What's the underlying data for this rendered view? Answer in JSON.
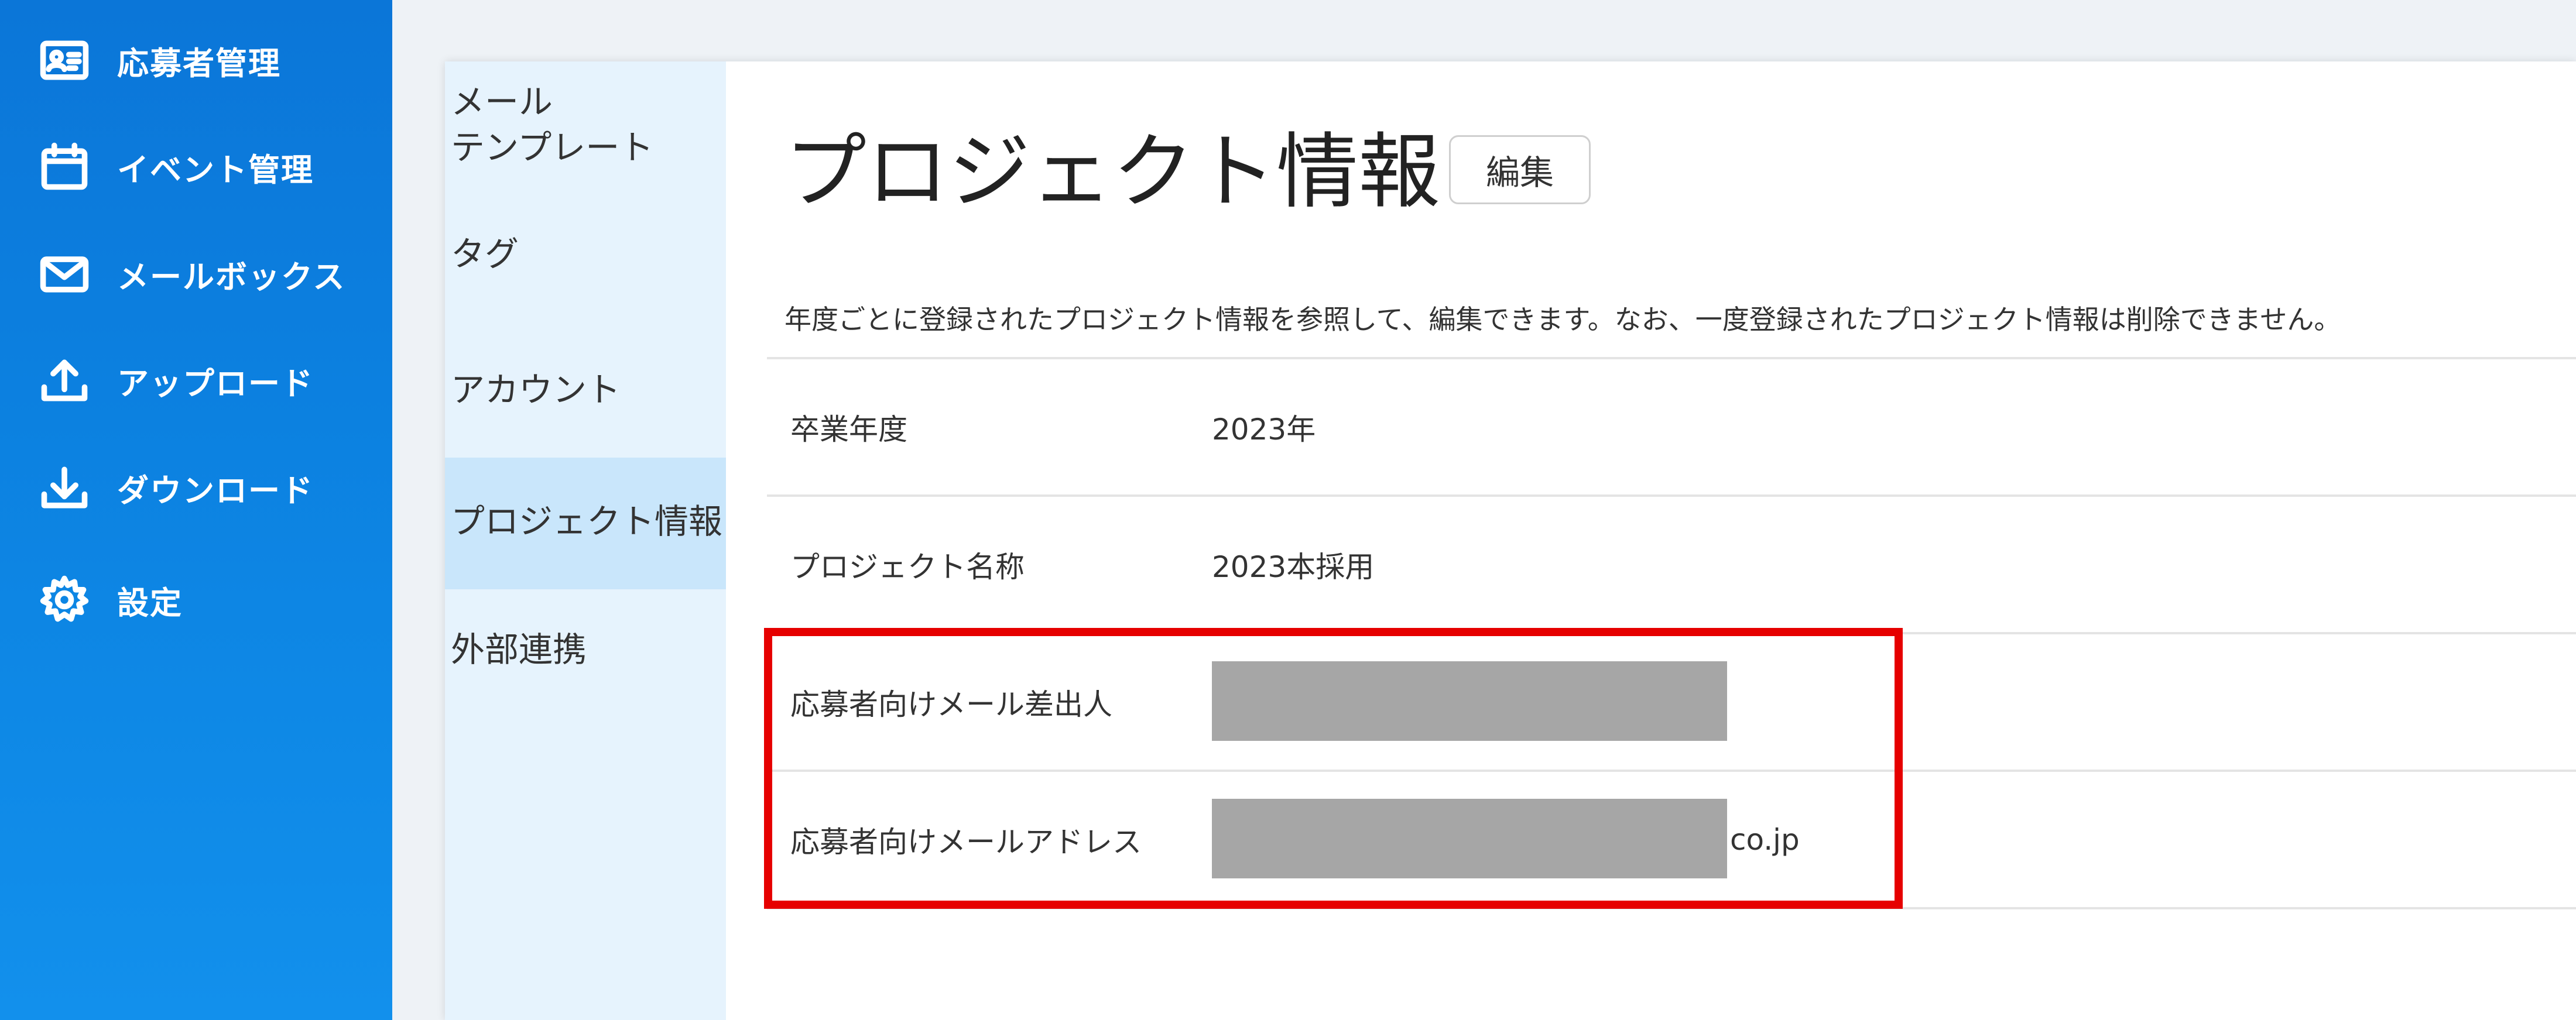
{
  "sidebar": {
    "items": [
      {
        "label": "応募者管理",
        "icon": "id-card-icon"
      },
      {
        "label": "イベント管理",
        "icon": "calendar-icon"
      },
      {
        "label": "メールボックス",
        "icon": "envelope-icon"
      },
      {
        "label": "アップロード",
        "icon": "upload-icon"
      },
      {
        "label": "ダウンロード",
        "icon": "download-icon"
      },
      {
        "label": "設定",
        "icon": "gear-icon"
      }
    ]
  },
  "subnav": {
    "items": [
      {
        "line1": "メール",
        "line2": "テンプレート"
      },
      {
        "label": "タグ"
      },
      {
        "label": "アカウント"
      },
      {
        "label": "プロジェクト情報",
        "active": true
      },
      {
        "label": "外部連携"
      }
    ]
  },
  "main": {
    "title": "プロジェクト情報",
    "edit_label": "編集",
    "description": "年度ごとに登録されたプロジェクト情報を参照して、編集できます。なお、一度登録されたプロジェクト情報は削除できません。",
    "rows": [
      {
        "label": "卒業年度",
        "value": "2023年"
      },
      {
        "label": "プロジェクト名称",
        "value": "2023本採用"
      },
      {
        "label": "応募者向けメール差出人"
      },
      {
        "label": "応募者向けメールアドレス",
        "suffix": "co.jp"
      }
    ]
  },
  "colors": {
    "sidebar": "#0b76d8",
    "subnav": "#e6f3fd",
    "subnav_active": "#c9e6fb",
    "highlight": "#e60000",
    "mask": "#a6a6a6"
  }
}
